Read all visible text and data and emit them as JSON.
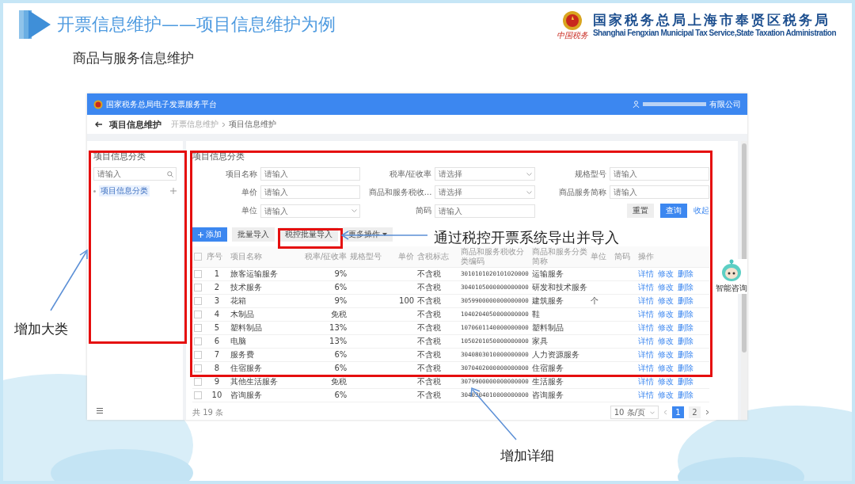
{
  "slide": {
    "title": "开票信息维护——项目信息维护为例",
    "org_name_cn": "国家税务总局上海市奉贤区税务局",
    "org_name_en": "Shanghai Fengxian Municipal Tax Service,State Taxation Administration",
    "org_slogan": "中国税务",
    "subtitle": "商品与服务信息维护"
  },
  "app": {
    "platform_title": "国家税务总局电子发票服务平台",
    "user_suffix": "有限公司",
    "page_title": "项目信息维护",
    "breadcrumb": [
      "开票信息维护",
      "项目信息维护"
    ],
    "sidebar": {
      "title": "项目信息分类",
      "search_placeholder": "请输入",
      "tree": [
        {
          "label": "项目信息分类"
        }
      ]
    },
    "panel_title": "项目信息分类",
    "filters": [
      {
        "label": "项目名称",
        "placeholder": "请输入",
        "kind": "input"
      },
      {
        "label": "税率/征收率",
        "placeholder": "请选择",
        "kind": "select"
      },
      {
        "label": "规格型号",
        "placeholder": "请输入",
        "kind": "input"
      },
      {
        "label": "单价",
        "placeholder": "请输入",
        "kind": "input"
      },
      {
        "label": "商品和服务税收...",
        "placeholder": "请选择",
        "kind": "select"
      },
      {
        "label": "商品服务简称",
        "placeholder": "请输入",
        "kind": "input"
      },
      {
        "label": "单位",
        "placeholder": "请输入",
        "kind": "select"
      },
      {
        "label": "简码",
        "placeholder": "请输入",
        "kind": "input"
      }
    ],
    "filter_buttons": [
      {
        "label": "重置",
        "kind": "default"
      },
      {
        "label": "查询",
        "kind": "primary"
      },
      {
        "label": "收起",
        "kind": "link"
      }
    ],
    "toolbar": [
      {
        "label": "添加",
        "kind": "primary"
      },
      {
        "label": "批量导入",
        "kind": "default"
      },
      {
        "label": "税控批量导入",
        "kind": "default"
      },
      {
        "label": "更多操作",
        "kind": "menu"
      }
    ],
    "table": {
      "select_all": {
        "checked": false
      },
      "columns": [
        "序号",
        "项目名称",
        "税率/征收率",
        "规格型号",
        "单价",
        "含税标志",
        "商品和服务税收分类编码",
        "商品和服务分类简称",
        "单位",
        "简码",
        "操作"
      ],
      "rows": [
        {
          "checked": false,
          "no": "1",
          "name": "旅客运输服务",
          "rate": "9%",
          "tax_flag": "不含税",
          "code": "3010101020101020000",
          "category": "运输服务",
          "actions": [
            "详情",
            "修改",
            "删除"
          ]
        },
        {
          "checked": false,
          "no": "2",
          "name": "技术服务",
          "rate": "6%",
          "tax_flag": "不含税",
          "code": "3040105000000000000",
          "category": "研发和技术服务",
          "actions": [
            "详情",
            "修改",
            "删除"
          ]
        },
        {
          "checked": false,
          "no": "3",
          "name": "花箱",
          "rate": "9%",
          "price": "100",
          "tax_flag": "不含税",
          "code": "3059900000000000000",
          "category": "建筑服务",
          "unit": "个",
          "actions": [
            "详情",
            "修改",
            "删除"
          ]
        },
        {
          "checked": false,
          "no": "4",
          "name": "木制品",
          "rate": "免税",
          "tax_flag": "不含税",
          "code": "1040204050000000000",
          "category": "鞋",
          "actions": [
            "详情",
            "修改",
            "删除"
          ]
        },
        {
          "checked": false,
          "no": "5",
          "name": "塑料制品",
          "rate": "13%",
          "tax_flag": "不含税",
          "code": "1070601140000000000",
          "category": "塑料制品",
          "actions": [
            "详情",
            "修改",
            "删除"
          ]
        },
        {
          "checked": false,
          "no": "6",
          "name": "电脑",
          "rate": "13%",
          "tax_flag": "不含税",
          "code": "1050201050000000000",
          "category": "家具",
          "actions": [
            "详情",
            "修改",
            "删除"
          ]
        },
        {
          "checked": false,
          "no": "7",
          "name": "服务费",
          "rate": "6%",
          "tax_flag": "不含税",
          "code": "3040803010000000000",
          "category": "人力资源服务",
          "actions": [
            "详情",
            "修改",
            "删除"
          ]
        },
        {
          "checked": false,
          "no": "8",
          "name": "住宿服务",
          "rate": "6%",
          "tax_flag": "不含税",
          "code": "3070402000000000000",
          "category": "住宿服务",
          "actions": [
            "详情",
            "修改",
            "删除"
          ]
        },
        {
          "checked": false,
          "no": "9",
          "name": "其他生活服务",
          "rate": "免税",
          "tax_flag": "不含税",
          "code": "3079900000000000000",
          "category": "生活服务",
          "actions": [
            "详情",
            "修改",
            "删除"
          ]
        },
        {
          "checked": false,
          "no": "10",
          "name": "咨询服务",
          "rate": "6%",
          "tax_flag": "不含税",
          "code": "3040304010000000000",
          "category": "咨询服务",
          "actions": [
            "详情",
            "修改",
            "删除"
          ]
        }
      ]
    },
    "pagination": {
      "total": "共 19 条",
      "page_size": "10 条/页",
      "pages": [
        {
          "label": "1",
          "selected": true
        },
        {
          "label": "2",
          "selected": false
        }
      ]
    },
    "assistant": {
      "label": "智能咨询"
    }
  },
  "annotations": [
    {
      "text": "通过税控开票系统导出并导入"
    },
    {
      "text": "增加大类"
    },
    {
      "text": "增加详细"
    }
  ]
}
